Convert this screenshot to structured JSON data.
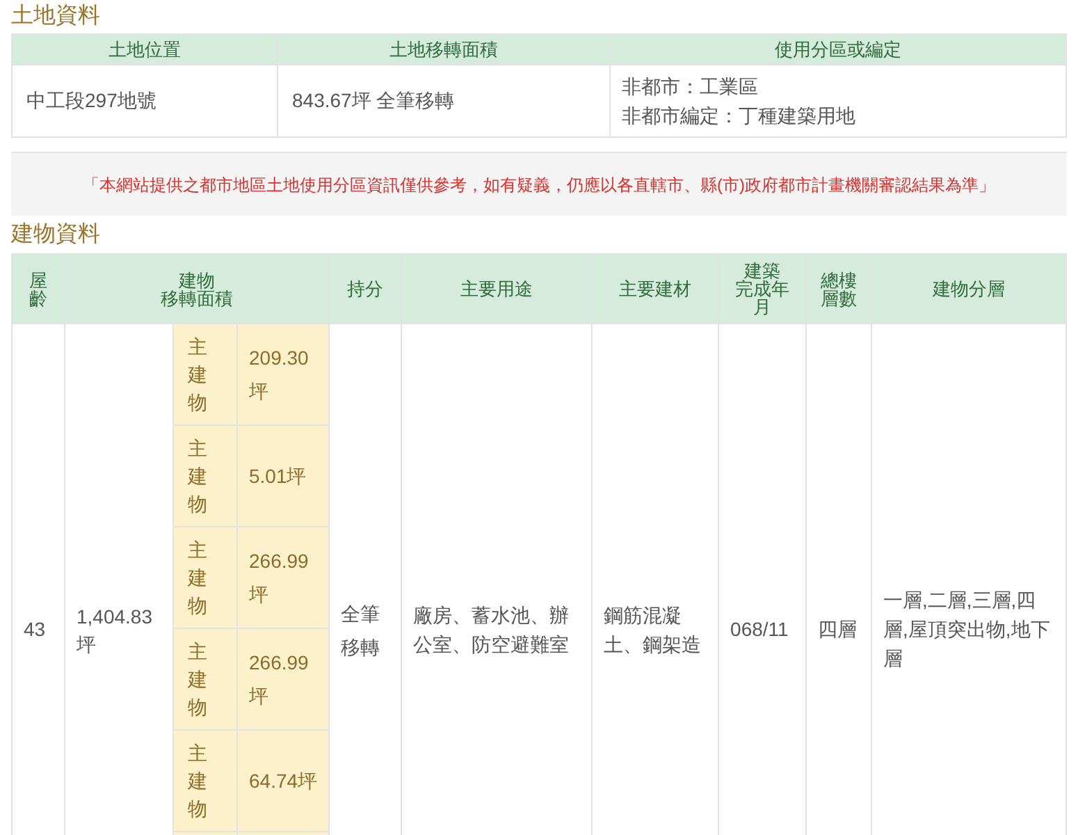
{
  "land": {
    "title": "土地資料",
    "columns": [
      "土地位置",
      "土地移轉面積",
      "使用分區或編定"
    ],
    "rows": [
      {
        "location": "中工段297地號",
        "area": "843.67坪 全筆移轉",
        "zoning": [
          "非都市：工業區",
          "非都市編定：丁種建築用地"
        ]
      }
    ]
  },
  "notice": "「本網站提供之都市地區土地使用分區資訊僅供參考，如有疑義，仍應以各直轄市、縣(市)政府都市計畫機關審認結果為準」",
  "building": {
    "title": "建物資料",
    "columns": [
      {
        "lines": [
          "屋",
          "齡"
        ]
      },
      {
        "lines": [
          "建物",
          "移轉面積"
        ]
      },
      {
        "lines": [
          "持分"
        ]
      },
      {
        "lines": [
          "主要用途"
        ]
      },
      {
        "lines": [
          "主要建材"
        ]
      },
      {
        "lines": [
          "建築",
          "完成年",
          "月"
        ]
      },
      {
        "lines": [
          "總樓",
          "層數"
        ]
      },
      {
        "lines": [
          "建物分層"
        ]
      }
    ],
    "rows": [
      {
        "age": "43",
        "area": "1,404.83坪",
        "share": "全筆移轉",
        "usage": "廠房、蓄水池、辦公室、防空避難室",
        "material": "鋼筋混凝土、鋼架造",
        "completed": "068/11",
        "floors": "四層",
        "layers": "一層,二層,三層,四層,屋頂突出物,地下層",
        "parts": [
          {
            "label": "主建物",
            "area": "209.30坪"
          },
          {
            "label": "主建物",
            "area": "5.01坪"
          },
          {
            "label": "主建物",
            "area": "266.99坪"
          },
          {
            "label": "主建物",
            "area": "266.99坪"
          },
          {
            "label": "主建物",
            "area": "64.74坪"
          }
        ]
      }
    ]
  }
}
